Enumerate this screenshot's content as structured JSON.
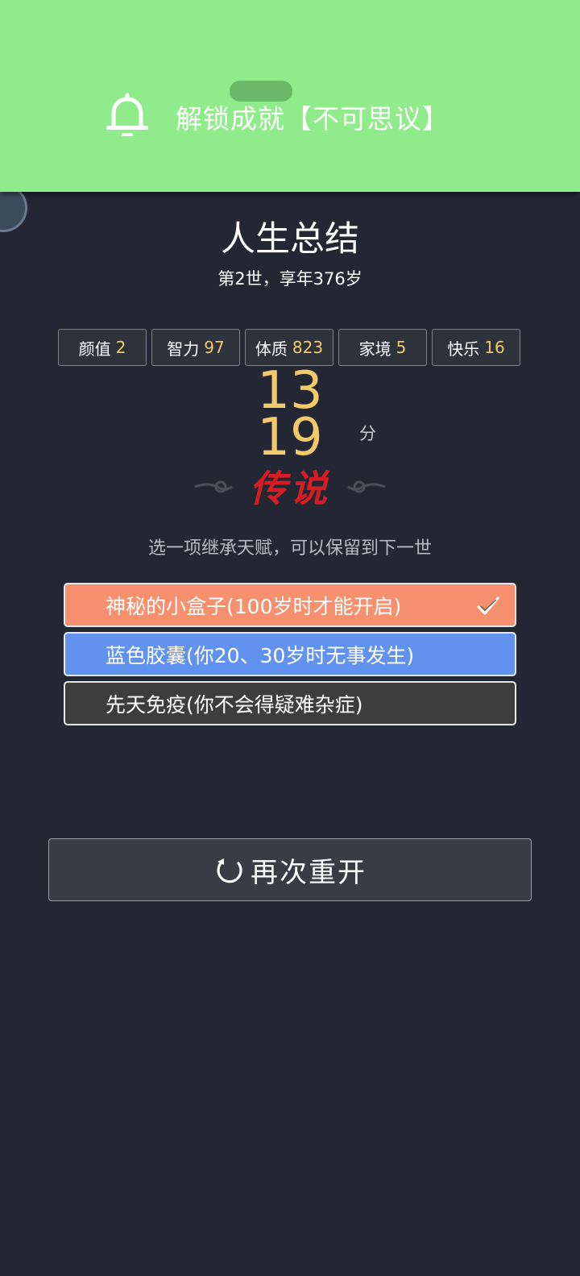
{
  "notification": {
    "text": "解锁成就【不可思议】",
    "icon": "bell-icon",
    "background": "#90ec8b"
  },
  "summary": {
    "title": "人生总结",
    "subtitle": "第2世，享年376岁"
  },
  "stats": [
    {
      "label": "颜值",
      "value": "2"
    },
    {
      "label": "智力",
      "value": "97"
    },
    {
      "label": "体质",
      "value": "823"
    },
    {
      "label": "家境",
      "value": "5"
    },
    {
      "label": "快乐",
      "value": "16"
    }
  ],
  "score": {
    "value": "1319",
    "unit": "分",
    "rank": "传说",
    "rank_color": "#d51d23",
    "value_color": "#f3c96a"
  },
  "inherit": {
    "prompt": "选一项继承天赋，可以保留到下一世",
    "options": [
      {
        "label": "神秘的小盒子(100岁时才能开启)",
        "color": "#f6906e",
        "selected": true
      },
      {
        "label": "蓝色胶囊(你20、30岁时无事发生)",
        "color": "#6193ee",
        "selected": false
      },
      {
        "label": "先天免疫(你不会得疑难杂症)",
        "color": "#3d3d3e",
        "selected": false
      }
    ]
  },
  "actions": {
    "restart_label": "再次重开",
    "restart_icon": "refresh-icon"
  }
}
